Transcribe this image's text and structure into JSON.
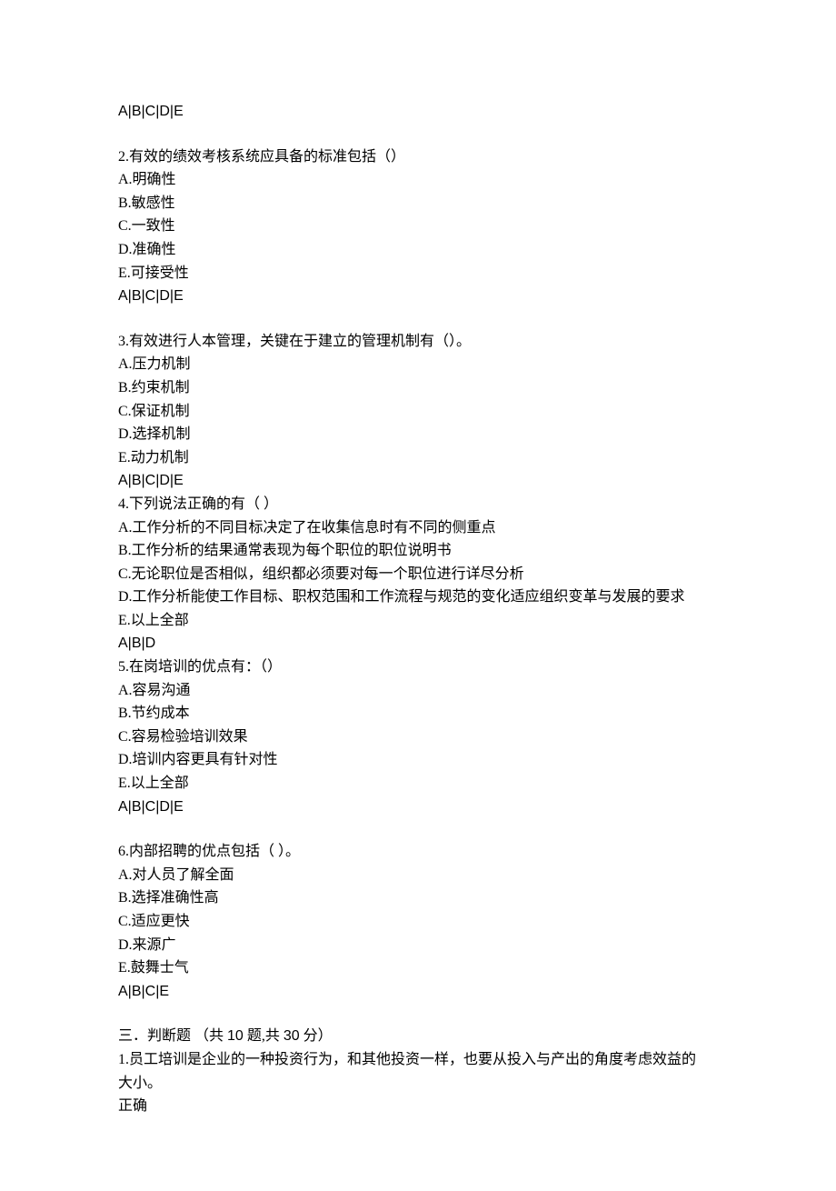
{
  "q1": {
    "answer": "A|B|C|D|E"
  },
  "q2": {
    "stem": "2.有效的绩效考核系统应具备的标准包括（）",
    "optA": "A.明确性",
    "optB": "B.敏感性",
    "optC": "C.一致性",
    "optD": "D.准确性",
    "optE": "E.可接受性",
    "answer": "A|B|C|D|E"
  },
  "q3": {
    "stem": "3.有效进行人本管理，关键在于建立的管理机制有（）。",
    "optA": "A.压力机制",
    "optB": "B.约束机制",
    "optC": "C.保证机制",
    "optD": "D.选择机制",
    "optE": "E.动力机制",
    "answer": "A|B|C|D|E"
  },
  "q4": {
    "stem": "4.下列说法正确的有（ ）",
    "optA": "A.工作分析的不同目标决定了在收集信息时有不同的侧重点",
    "optB": "B.工作分析的结果通常表现为每个职位的职位说明书",
    "optC": "C.无论职位是否相似，组织都必须要对每一个职位进行详尽分析",
    "optD": "D.工作分析能使工作目标、职权范围和工作流程与规范的变化适应组织变革与发展的要求",
    "optE": "E.以上全部",
    "answer": "A|B|D"
  },
  "q5": {
    "stem": "5.在岗培训的优点有：（）",
    "optA": "A.容易沟通",
    "optB": "B.节约成本",
    "optC": "C.容易检验培训效果",
    "optD": "D.培训内容更具有针对性",
    "optE": "E.以上全部",
    "answer": "A|B|C|D|E"
  },
  "q6": {
    "stem": "6.内部招聘的优点包括（ ）。",
    "optA": "A.对人员了解全面",
    "optB": "B.选择准确性高",
    "optC": "C.适应更快",
    "optD": "D.来源广",
    "optE": "E.鼓舞士气",
    "answer": "A|B|C|E"
  },
  "section3": {
    "title_prefix": "三．判断题 （共 ",
    "title_num1": "10",
    "title_mid": " 题,共 ",
    "title_num2": "30",
    "title_suffix": " 分）"
  },
  "tf1": {
    "stem_line1": "1.员工培训是企业的一种投资行为，和其他投资一样，也要从投入与产出的角度考虑效益的",
    "stem_line2": "大小。",
    "answer": "正确"
  }
}
